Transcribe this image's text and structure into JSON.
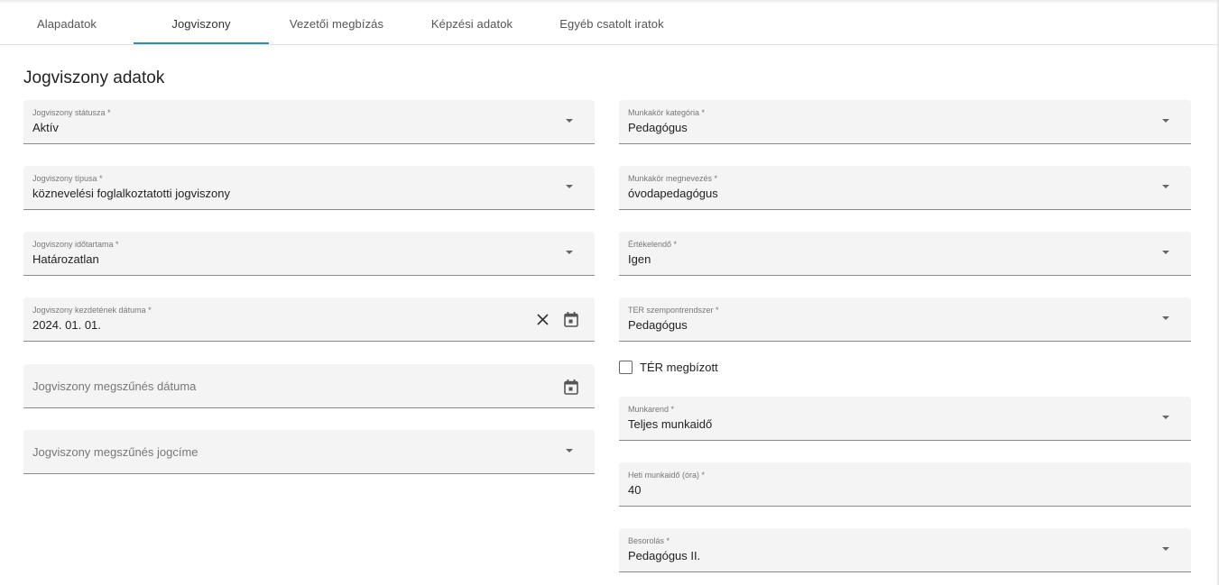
{
  "tabs": [
    {
      "label": "Alapadatok"
    },
    {
      "label": "Jogviszony"
    },
    {
      "label": "Vezetői megbízás"
    },
    {
      "label": "Képzési adatok"
    },
    {
      "label": "Egyéb csatolt iratok"
    }
  ],
  "active_tab": "Jogviszony",
  "section_title": "Jogviszony adatok",
  "left": {
    "status": {
      "label": "Jogviszony státusza *",
      "value": "Aktív"
    },
    "type": {
      "label": "Jogviszony típusa *",
      "value": "köznevelési foglalkoztatotti jogviszony"
    },
    "duration": {
      "label": "Jogviszony időtartama *",
      "value": "Határozatlan"
    },
    "start_date": {
      "label": "Jogviszony kezdetének dátuma *",
      "value": "2024. 01. 01."
    },
    "end_date": {
      "placeholder": "Jogviszony megszűnés dátuma"
    },
    "end_reason": {
      "placeholder": "Jogviszony megszűnés jogcíme"
    }
  },
  "right": {
    "job_category": {
      "label": "Munkakör kategória *",
      "value": "Pedagógus"
    },
    "job_name": {
      "label": "Munkakör megnevezés *",
      "value": "óvodapedagógus"
    },
    "evaluated": {
      "label": "Értékelendő *",
      "value": "Igen"
    },
    "ter_system": {
      "label": "TER szempontrendszer *",
      "value": "Pedagógus"
    },
    "ter_appointed": {
      "label": "TÉR megbízott",
      "checked": false
    },
    "work_schedule": {
      "label": "Munkarend *",
      "value": "Teljes munkaidő"
    },
    "weekly_hours": {
      "label": "Heti munkaidő (óra) *",
      "value": "40"
    },
    "classification": {
      "label": "Besorolás *",
      "value": "Pedagógus II."
    }
  },
  "icons": {
    "dropdown": "chevron-down-icon",
    "calendar": "calendar-icon",
    "clear": "close-icon"
  },
  "colors": {
    "accent": "#2b8fb1",
    "field_bg": "#f4f4f4",
    "field_border": "#8a8a8a"
  }
}
